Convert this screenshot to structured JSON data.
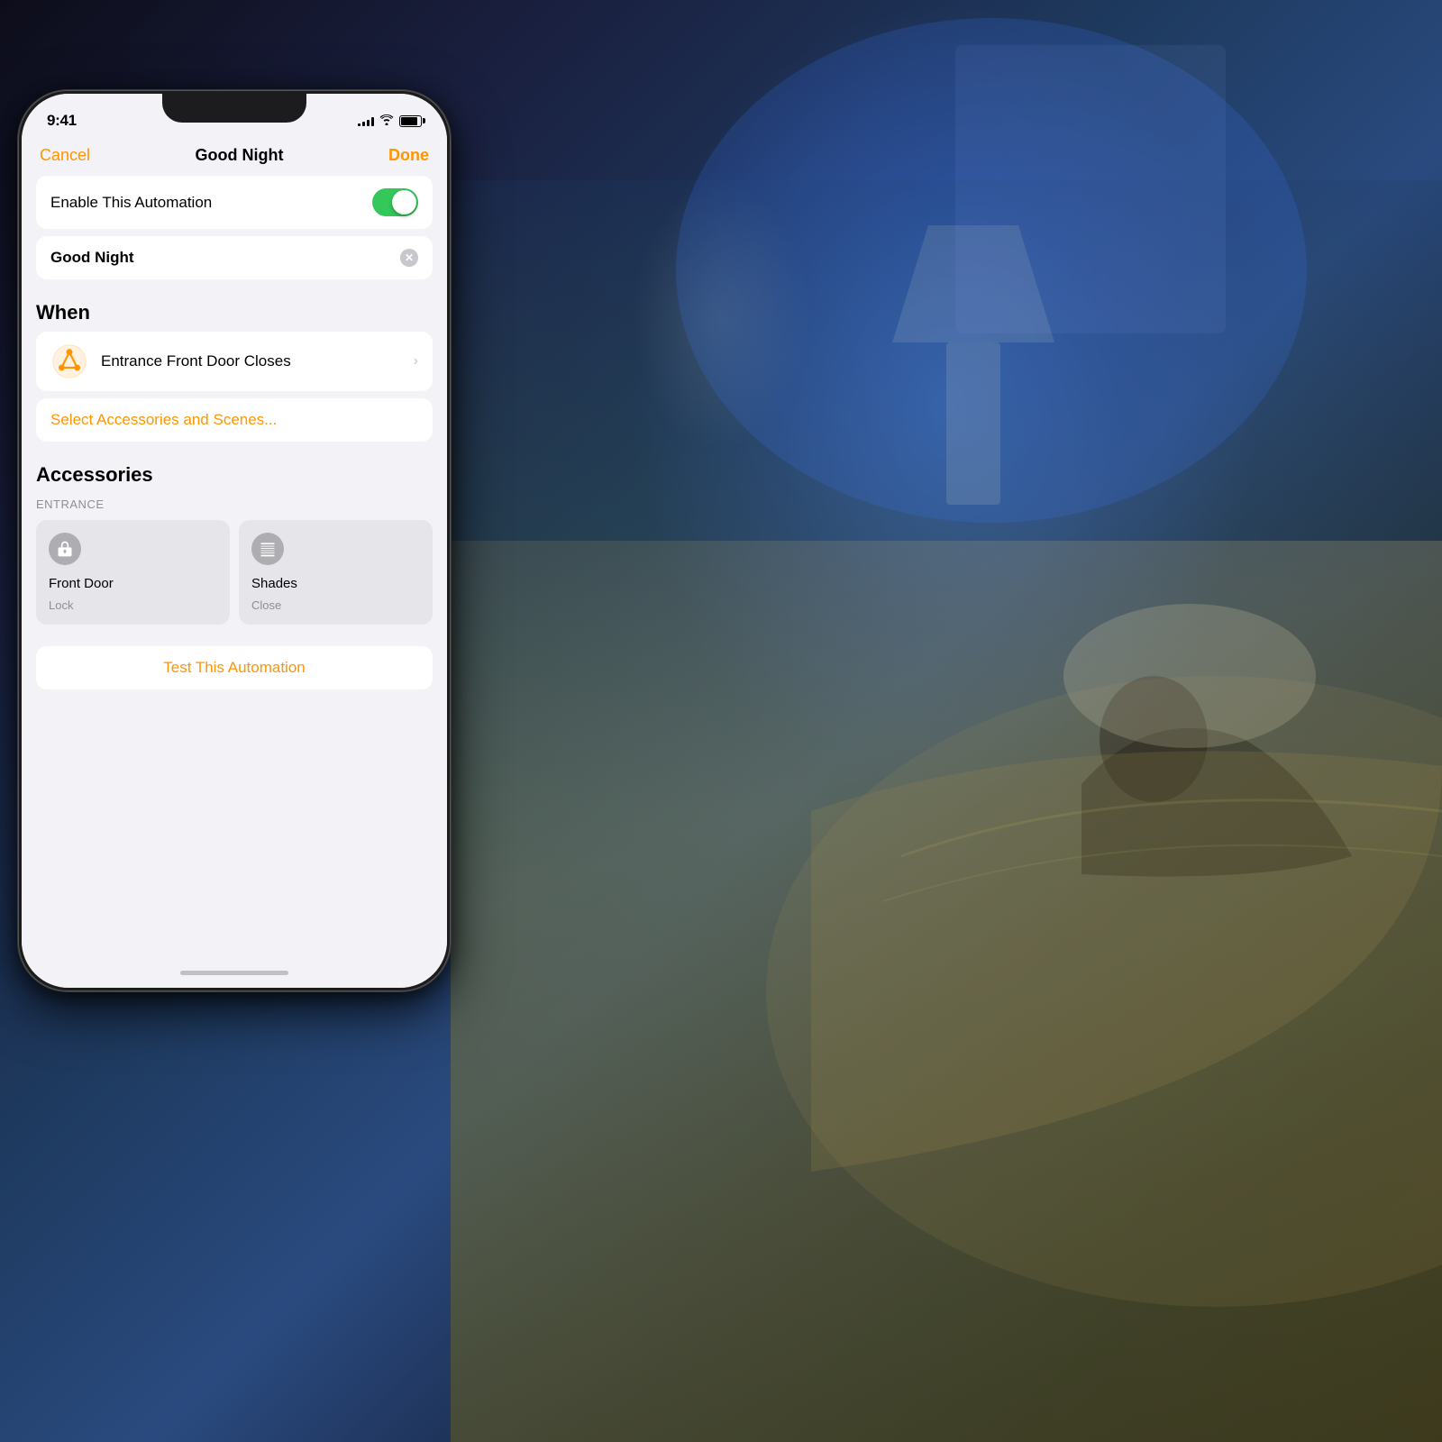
{
  "background": {
    "description": "Bedroom scene with sleeping person, blue ambient lighting"
  },
  "statusBar": {
    "time": "9:41",
    "signal": [
      3,
      5,
      7,
      9,
      11
    ],
    "battery_level": 85
  },
  "navigation": {
    "cancel_label": "Cancel",
    "title": "Good Night",
    "done_label": "Done"
  },
  "enableToggle": {
    "label": "Enable This Automation",
    "enabled": true
  },
  "automationName": {
    "name": "Good Night",
    "clearButtonLabel": "×"
  },
  "whenSection": {
    "header": "When",
    "trigger": {
      "label": "Entrance Front Door Closes",
      "icon": "homekit-triangle-icon"
    }
  },
  "actionsSection": {
    "select_label": "Select Accessories and Scenes..."
  },
  "accessoriesSection": {
    "header": "Accessories",
    "group_label": "ENTRANCE",
    "items": [
      {
        "name": "Front Door",
        "state": "Lock",
        "icon": "lock-icon"
      },
      {
        "name": "Shades",
        "state": "Close",
        "icon": "shades-icon"
      }
    ]
  },
  "testButton": {
    "label": "Test This Automation"
  },
  "colors": {
    "orange": "#FF9500",
    "green": "#34C759",
    "gray_bg": "#f2f2f7",
    "card_bg": "#ffffff",
    "accessory_bg": "#e5e5ea",
    "icon_gray": "#aeaeb2",
    "text_secondary": "#8e8e93"
  }
}
